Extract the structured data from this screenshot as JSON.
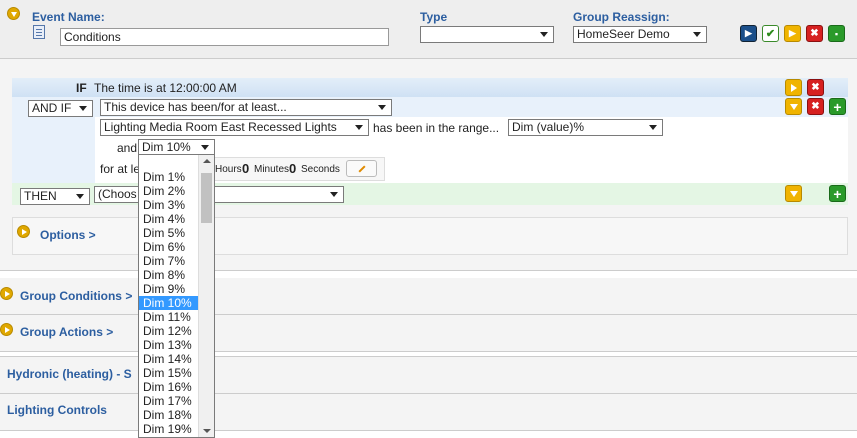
{
  "event": {
    "name_label": "Event Name:",
    "name_value": "Conditions",
    "type_label": "Type",
    "type_value": "",
    "group_reassign_label": "Group Reassign:",
    "group_reassign_value": "HomeSeer Demo"
  },
  "toolbar": {
    "run_label": "▶",
    "save_label": "✔",
    "play_label": "▶",
    "delete_label": "✖",
    "copy_label": "▪"
  },
  "if_block": {
    "if_label": "IF",
    "if_text": "The time is at 12:00:00 AM",
    "and_if_value": "AND IF",
    "device_condition": "This device has been/for at least...",
    "device_value": "Lighting Media Room East Recessed Lights",
    "range_text": "has been in the range...",
    "range_value": "Dim (value)%",
    "and_is_label": "and is",
    "and_is_value": "Dim 10%",
    "for_at_label": "for at le",
    "hours_value": "0",
    "hours_label": "Hours",
    "minutes_value": "0",
    "minutes_label": "Minutes",
    "seconds_value": "0",
    "seconds_label": "Seconds"
  },
  "then_block": {
    "then_value": "THEN",
    "action_value": "(Choos"
  },
  "options_label": "Options >",
  "sections": {
    "group_conditions": "Group Conditions >",
    "group_actions": "Group Actions >",
    "hydronic": "Hydronic (heating) - S",
    "lighting": "Lighting Controls"
  },
  "dim_options": [
    "Dim 1%",
    "Dim 2%",
    "Dim 3%",
    "Dim 4%",
    "Dim 5%",
    "Dim 6%",
    "Dim 7%",
    "Dim 8%",
    "Dim 9%",
    "Dim 10%",
    "Dim 11%",
    "Dim 12%",
    "Dim 13%",
    "Dim 14%",
    "Dim 15%",
    "Dim 16%",
    "Dim 17%",
    "Dim 18%",
    "Dim 19%"
  ],
  "selected_option": "Dim 10%"
}
